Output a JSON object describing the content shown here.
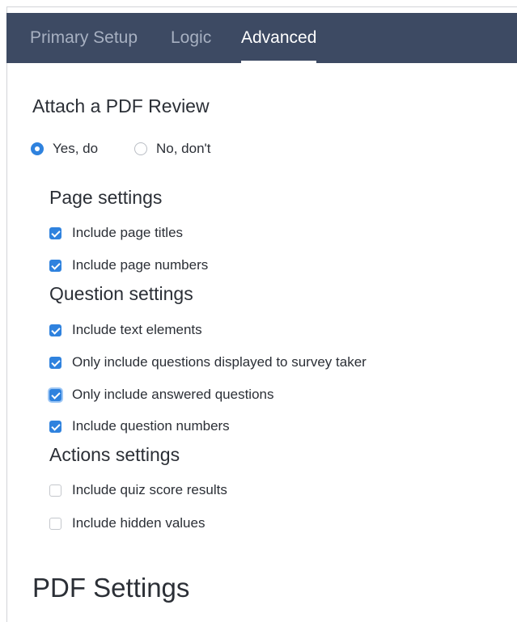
{
  "tabs": [
    {
      "label": "Primary Setup",
      "active": false
    },
    {
      "label": "Logic",
      "active": false
    },
    {
      "label": "Advanced",
      "active": true
    }
  ],
  "attach_pdf": {
    "title": "Attach a PDF Review",
    "options": [
      {
        "label": "Yes, do",
        "selected": true
      },
      {
        "label": "No, don't",
        "selected": false
      }
    ]
  },
  "page_settings": {
    "heading": "Page settings",
    "items": [
      {
        "label": "Include page titles",
        "checked": true
      },
      {
        "label": "Include page numbers",
        "checked": true
      }
    ]
  },
  "question_settings": {
    "heading": "Question settings",
    "items": [
      {
        "label": "Include text elements",
        "checked": true
      },
      {
        "label": "Only include questions displayed to survey taker",
        "checked": true
      },
      {
        "label": "Only include answered questions",
        "checked": true,
        "focused": true
      },
      {
        "label": "Include question numbers",
        "checked": true
      }
    ]
  },
  "actions_settings": {
    "heading": "Actions settings",
    "items": [
      {
        "label": "Include quiz score results",
        "checked": false
      },
      {
        "label": "Include hidden values",
        "checked": false
      }
    ]
  },
  "pdf_settings": {
    "heading": "PDF Settings"
  },
  "colors": {
    "tabbar_bg": "#3d4a63",
    "accent": "#2f82de",
    "text": "#2b2f36"
  }
}
